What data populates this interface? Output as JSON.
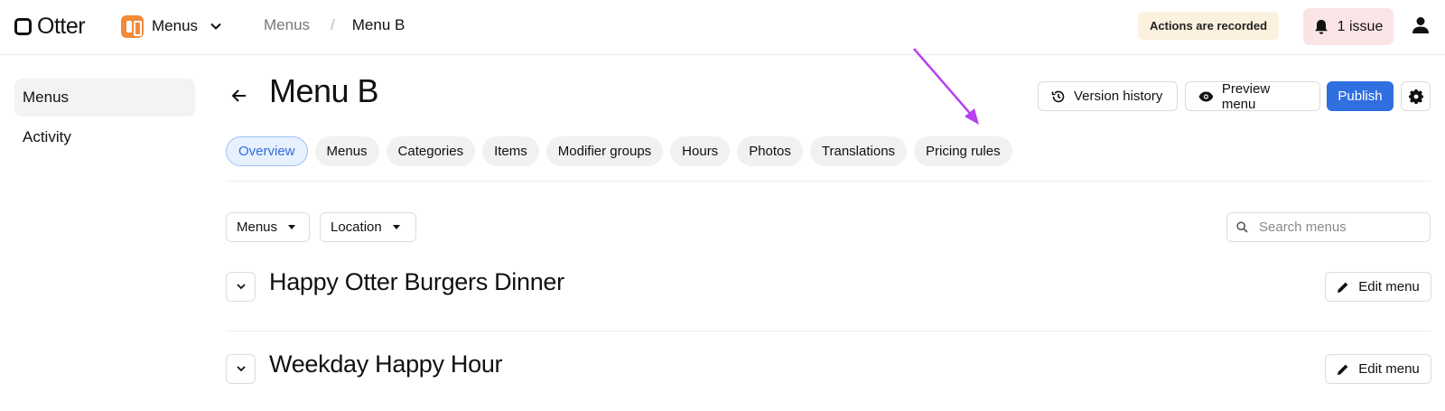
{
  "brand": {
    "name": "Otter"
  },
  "app_switcher": {
    "label": "Menus",
    "icon": "menus-app-icon"
  },
  "breadcrumb": {
    "parent": "Menus",
    "separator": "/",
    "current": "Menu B"
  },
  "header_right": {
    "recorded_badge": "Actions are recorded",
    "issue_label": "1 issue"
  },
  "sidebar": {
    "items": [
      {
        "label": "Menus",
        "active": true
      },
      {
        "label": "Activity",
        "active": false
      }
    ]
  },
  "page": {
    "title": "Menu B"
  },
  "actions": {
    "version_history": "Version history",
    "preview_menu": "Preview menu",
    "publish": "Publish"
  },
  "tabs": [
    {
      "label": "Overview",
      "active": true
    },
    {
      "label": "Menus",
      "active": false
    },
    {
      "label": "Categories",
      "active": false
    },
    {
      "label": "Items",
      "active": false
    },
    {
      "label": "Modifier groups",
      "active": false
    },
    {
      "label": "Hours",
      "active": false
    },
    {
      "label": "Photos",
      "active": false
    },
    {
      "label": "Translations",
      "active": false
    },
    {
      "label": "Pricing rules",
      "active": false
    }
  ],
  "filters": {
    "menus_label": "Menus",
    "location_label": "Location"
  },
  "search": {
    "placeholder": "Search menus",
    "value": ""
  },
  "menu_rows": [
    {
      "title": "Happy Otter Burgers Dinner",
      "edit_label": "Edit menu"
    },
    {
      "title": "Weekday Happy Hour",
      "edit_label": "Edit menu"
    }
  ],
  "colors": {
    "accent": "#2f6fe0",
    "annotation_arrow": "#b63ff0",
    "badge_bg": "#fbf1de",
    "issue_bg": "#fbe4e6"
  }
}
